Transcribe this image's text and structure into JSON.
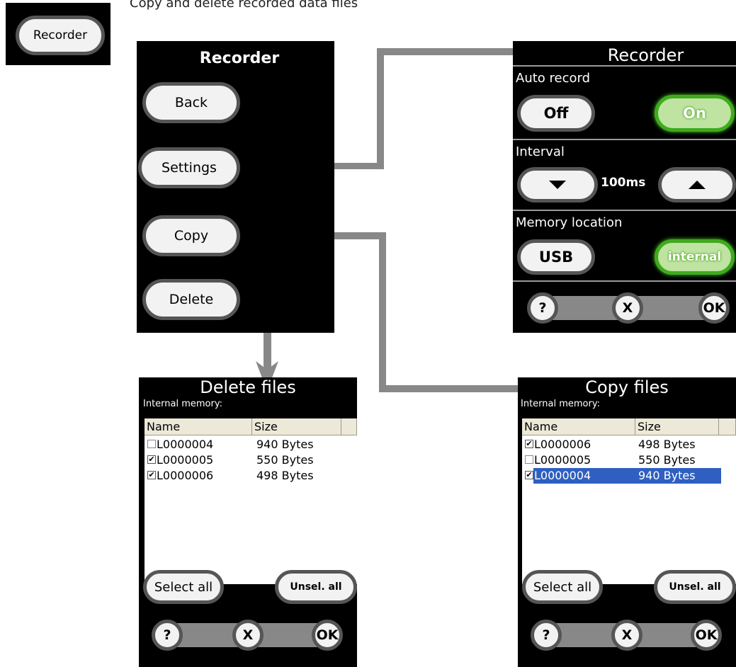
{
  "caption": "Copy and delete recorded data files",
  "recorder_icon": {
    "label": "Recorder"
  },
  "menu": {
    "title": "Recorder",
    "buttons": [
      "Back",
      "Settings",
      "Copy",
      "Delete"
    ]
  },
  "settings": {
    "title": "Recorder",
    "auto_record": {
      "label": "Auto record",
      "off": "Off",
      "on": "On"
    },
    "interval": {
      "label": "Interval",
      "value": "100ms"
    },
    "memory": {
      "label": "Memory location",
      "usb": "USB",
      "internal": "internal"
    },
    "bottom": {
      "help": "?",
      "cancel": "X",
      "ok": "OK"
    }
  },
  "delete_files": {
    "title": "Delete files",
    "subtitle": "Internal memory:",
    "columns": [
      "Name",
      "Size"
    ],
    "rows": [
      {
        "name": "L0000004",
        "size": "940 Bytes",
        "checked": false
      },
      {
        "name": "L0000005",
        "size": "550 Bytes",
        "checked": true
      },
      {
        "name": "L0000006",
        "size": "498 Bytes",
        "checked": true
      }
    ],
    "select_all": "Select all",
    "unselect_all": "Unsel. all",
    "bottom": {
      "help": "?",
      "cancel": "X",
      "ok": "OK"
    }
  },
  "copy_files": {
    "title": "Copy files",
    "subtitle": "Internal memory:",
    "columns": [
      "Name",
      "Size"
    ],
    "rows": [
      {
        "name": "L0000006",
        "size": "498 Bytes",
        "checked": true
      },
      {
        "name": "L0000005",
        "size": "550 Bytes",
        "checked": false
      },
      {
        "name": "L0000004",
        "size": "940 Bytes",
        "checked": true,
        "selected": true
      }
    ],
    "select_all": "Select all",
    "unselect_all": "Unsel. all",
    "bottom": {
      "help": "?",
      "cancel": "X",
      "ok": "OK"
    }
  },
  "colors": {
    "connector": "#888888",
    "highlight": "#2e5fc1",
    "on_green": "#3faa1e"
  }
}
